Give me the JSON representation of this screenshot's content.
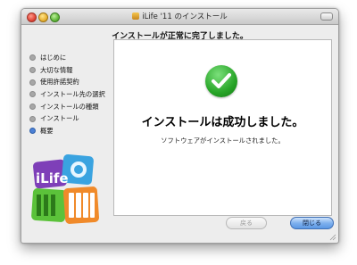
{
  "window": {
    "title": "iLife '11 のインストール"
  },
  "header": {
    "heading": "インストールが正常に完了しました。"
  },
  "sidebar": {
    "steps": [
      {
        "label": "はじめに",
        "active": false
      },
      {
        "label": "大切な情報",
        "active": false
      },
      {
        "label": "使用許諾契約",
        "active": false
      },
      {
        "label": "インストール先の選択",
        "active": false
      },
      {
        "label": "インストールの種類",
        "active": false
      },
      {
        "label": "インストール",
        "active": false
      },
      {
        "label": "概要",
        "active": true
      }
    ]
  },
  "main": {
    "status_icon": "checkmark-icon",
    "success_text": "インストールは成功しました。",
    "detail_text": "ソフトウェアがインストールされました。"
  },
  "logo": {
    "text": "iLife"
  },
  "buttons": {
    "back_label": "戻る",
    "close_label": "閉じる"
  },
  "colors": {
    "accent": "#5b98e4",
    "success": "#28a528",
    "active_step": "#4b80d6"
  }
}
